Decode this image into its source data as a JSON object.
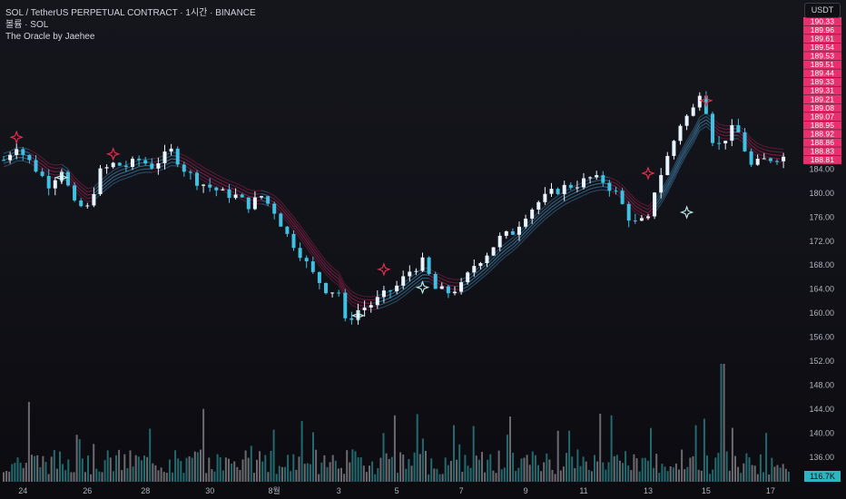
{
  "header": {
    "symbol_line": "SOL / TetherUS PERPETUAL CONTRACT · 1시간 · BINANCE",
    "volume_line": "볼륨 · SOL",
    "indicator_line": "The Oracle by Jaehee"
  },
  "axis": {
    "unit_label": "USDT",
    "volume_value": "116.7K"
  },
  "colors": {
    "up_candle": "#e8f4ff",
    "down_candle": "#3ec1e3",
    "bull_ribbon": "#4fa9dc",
    "bear_ribbon": "#c2275f",
    "price_tag": "#e8306e",
    "volume_teal": "#2a8a8e",
    "volume_gray": "#8a8a90"
  },
  "chart_data": {
    "type": "candlestick",
    "y_axis": {
      "ylim": [
        134.5,
        191.0
      ],
      "ticks": [
        "184.00",
        "180.00",
        "176.00",
        "172.00",
        "168.00",
        "164.00",
        "160.00",
        "156.00",
        "152.00",
        "148.00",
        "144.00",
        "140.00",
        "136.00"
      ],
      "tag_labels": [
        "190.33",
        "189.96",
        "189.61",
        "189.54",
        "189.53",
        "189.51",
        "189.44",
        "189.33",
        "189.31",
        "189.21",
        "189.08",
        "189.07",
        "188.95",
        "188.92",
        "188.86",
        "188.83",
        "188.81"
      ]
    },
    "x_axis": {
      "ticks": [
        {
          "label": "24",
          "index": 3
        },
        {
          "label": "26",
          "index": 13
        },
        {
          "label": "28",
          "index": 22
        },
        {
          "label": "30",
          "index": 32
        },
        {
          "label": "8월",
          "index": 42
        },
        {
          "label": "3",
          "index": 52
        },
        {
          "label": "5",
          "index": 61
        },
        {
          "label": "7",
          "index": 71
        },
        {
          "label": "9",
          "index": 81
        },
        {
          "label": "11",
          "index": 90
        },
        {
          "label": "13",
          "index": 100
        },
        {
          "label": "15",
          "index": 109
        },
        {
          "label": "17",
          "index": 119
        }
      ]
    },
    "price_keypoints": [
      {
        "i": 0,
        "v": 185.5
      },
      {
        "i": 2,
        "v": 188.0
      },
      {
        "i": 3,
        "v": 186.5
      },
      {
        "i": 5,
        "v": 184.0
      },
      {
        "i": 7,
        "v": 181.5
      },
      {
        "i": 9,
        "v": 184.0
      },
      {
        "i": 11,
        "v": 178.0
      },
      {
        "i": 13,
        "v": 177.5
      },
      {
        "i": 15,
        "v": 183.5
      },
      {
        "i": 17,
        "v": 184.8
      },
      {
        "i": 19,
        "v": 184.5
      },
      {
        "i": 21,
        "v": 185.5
      },
      {
        "i": 23,
        "v": 184.5
      },
      {
        "i": 26,
        "v": 187.0
      },
      {
        "i": 28,
        "v": 184.0
      },
      {
        "i": 30,
        "v": 182.0
      },
      {
        "i": 32,
        "v": 181.0
      },
      {
        "i": 34,
        "v": 180.0
      },
      {
        "i": 36,
        "v": 179.5
      },
      {
        "i": 38,
        "v": 178.0
      },
      {
        "i": 40,
        "v": 179.5
      },
      {
        "i": 42,
        "v": 177.0
      },
      {
        "i": 44,
        "v": 173.0
      },
      {
        "i": 46,
        "v": 170.0
      },
      {
        "i": 48,
        "v": 166.5
      },
      {
        "i": 50,
        "v": 164.0
      },
      {
        "i": 52,
        "v": 163.5
      },
      {
        "i": 53,
        "v": 158.5
      },
      {
        "i": 55,
        "v": 160.5
      },
      {
        "i": 57,
        "v": 161.5
      },
      {
        "i": 59,
        "v": 163.0
      },
      {
        "i": 61,
        "v": 164.5
      },
      {
        "i": 63,
        "v": 167.0
      },
      {
        "i": 65,
        "v": 168.5
      },
      {
        "i": 67,
        "v": 164.0
      },
      {
        "i": 69,
        "v": 163.5
      },
      {
        "i": 71,
        "v": 164.5
      },
      {
        "i": 73,
        "v": 168.0
      },
      {
        "i": 75,
        "v": 170.0
      },
      {
        "i": 77,
        "v": 172.5
      },
      {
        "i": 79,
        "v": 173.5
      },
      {
        "i": 81,
        "v": 176.5
      },
      {
        "i": 83,
        "v": 178.5
      },
      {
        "i": 85,
        "v": 180.0
      },
      {
        "i": 87,
        "v": 181.0
      },
      {
        "i": 89,
        "v": 181.5
      },
      {
        "i": 91,
        "v": 182.5
      },
      {
        "i": 93,
        "v": 182.0
      },
      {
        "i": 95,
        "v": 180.0
      },
      {
        "i": 97,
        "v": 176.0
      },
      {
        "i": 98,
        "v": 175.0
      },
      {
        "i": 100,
        "v": 175.5
      },
      {
        "i": 101,
        "v": 180.5
      },
      {
        "i": 103,
        "v": 186.0
      },
      {
        "i": 105,
        "v": 191.5
      },
      {
        "i": 107,
        "v": 194.0
      },
      {
        "i": 108,
        "v": 197.0
      },
      {
        "i": 109,
        "v": 194.0
      },
      {
        "i": 110,
        "v": 189.0
      },
      {
        "i": 111,
        "v": 188.0
      },
      {
        "i": 113,
        "v": 190.5
      },
      {
        "i": 114,
        "v": 190.0
      },
      {
        "i": 116,
        "v": 184.5
      },
      {
        "i": 118,
        "v": 185.5
      },
      {
        "i": 120,
        "v": 186.0
      }
    ],
    "signals": [
      {
        "type": "sell",
        "i": 2,
        "v": 189.3
      },
      {
        "type": "buy",
        "i": 9,
        "v": 182.6
      },
      {
        "type": "sell",
        "i": 17,
        "v": 186.5
      },
      {
        "type": "buy",
        "i": 55,
        "v": 159.6
      },
      {
        "type": "sell",
        "i": 59,
        "v": 167.3
      },
      {
        "type": "buy",
        "i": 65,
        "v": 164.3
      },
      {
        "type": "sell",
        "i": 100,
        "v": 183.3
      },
      {
        "type": "buy",
        "i": 106,
        "v": 176.8
      },
      {
        "type": "sell",
        "i": 109,
        "v": 195.4
      }
    ]
  }
}
